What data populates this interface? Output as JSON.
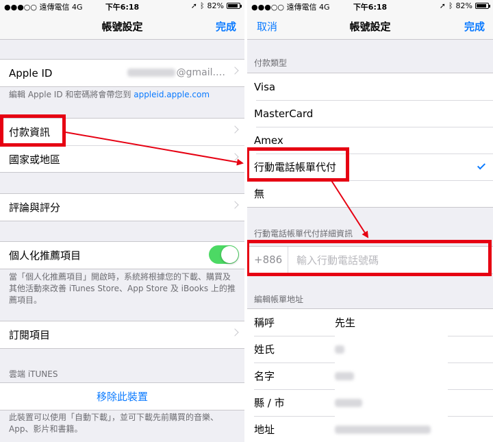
{
  "status": {
    "carrier": "●●●○○ 遠傳電信  4G",
    "time": "下午6:18",
    "battery": "82%",
    "battery_level": 0.82,
    "location_icon": "location-arrow-icon",
    "bluetooth_icon": "bluetooth-icon"
  },
  "left": {
    "nav": {
      "title": "帳號設定",
      "done": "完成"
    },
    "apple_id": {
      "label": "Apple ID",
      "value": "@gmail.…"
    },
    "apple_id_note_prefix": "編輯 Apple ID 和密碼將會帶您到",
    "apple_id_note_link": "appleid.apple.com",
    "payment_info": "付款資訊",
    "country": "國家或地區",
    "ratings": "評論與評分",
    "personalized": "個人化推薦項目",
    "personalized_on": true,
    "personalized_note": "當「個人化推薦項目」開啟時，系統將根據您的下載、購買及其他活動來改善 iTunes Store、App Store 及 iBooks 上的推薦項目。",
    "subscriptions": "訂閱項目",
    "itunes_cloud_header": "雲端 iTUNES",
    "remove_device": "移除此裝置",
    "remove_note": "此裝置可以使用「自動下載」，並可下載先前購買的音樂、App、影片和書籍。"
  },
  "right": {
    "nav": {
      "title": "帳號設定",
      "cancel": "取消",
      "done": "完成"
    },
    "payment_type_header": "付款類型",
    "payment_types": [
      "Visa",
      "MasterCard",
      "Amex",
      "行動電話帳單代付",
      "無"
    ],
    "selected_index": 3,
    "carrier_billing_header": "行動電話帳單代付詳細資訊",
    "country_code": "+886",
    "phone_placeholder": "輸入行動電話號碼",
    "billing_address_header": "編輯帳單地址",
    "address_fields": [
      {
        "label": "稱呼",
        "value": "先生"
      },
      {
        "label": "姓氏",
        "value": ""
      },
      {
        "label": "名字",
        "value": ""
      },
      {
        "label": "縣 / 市",
        "value": ""
      },
      {
        "label": "地址",
        "value": ""
      }
    ]
  },
  "colors": {
    "accent": "#0a7aff",
    "highlight": "#e60012",
    "toggle_on": "#4cd964",
    "background": "#efeff4"
  }
}
